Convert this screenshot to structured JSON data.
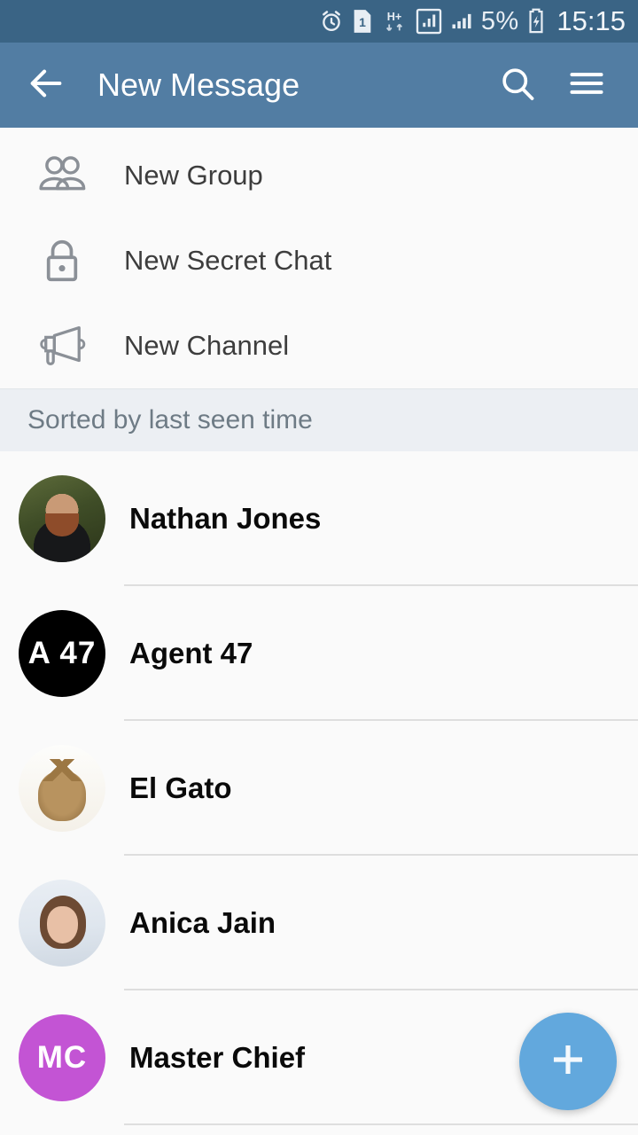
{
  "status_bar": {
    "icons": [
      "alarm-clock-icon",
      "sim-card-1-icon",
      "hplus-network-icon",
      "signal-data-icon",
      "signal-bars-icon"
    ],
    "battery_percent": "5%",
    "battery_state": "charging",
    "clock": "15:15"
  },
  "app_bar": {
    "back_label": "back-arrow",
    "title": "New Message",
    "search_label": "search",
    "menu_label": "menu"
  },
  "action_menu": [
    {
      "icon": "people-icon",
      "label": "New Group"
    },
    {
      "icon": "lock-icon",
      "label": "New Secret Chat"
    },
    {
      "icon": "megaphone-icon",
      "label": "New Channel"
    }
  ],
  "sort_header": {
    "label": "Sorted by last seen time"
  },
  "contacts": [
    {
      "name": "Nathan Jones",
      "avatar_type": "photo",
      "avatar_photo": "bearded-man-portrait"
    },
    {
      "name": "Agent 47",
      "avatar_type": "initials",
      "initials": "A 47",
      "color": "#000000"
    },
    {
      "name": "El Gato",
      "avatar_type": "photo",
      "avatar_photo": "tabby-cat"
    },
    {
      "name": "Anica Jain",
      "avatar_type": "photo",
      "avatar_photo": "woman-portrait"
    },
    {
      "name": "Master Chief",
      "avatar_type": "initials",
      "initials": "MC",
      "color": "#c354d4"
    }
  ],
  "fab": {
    "label": "+",
    "color": "#62a8dd"
  },
  "colors": {
    "status_bar": "#3a6485",
    "app_bar": "#527da3",
    "background": "#fafafa",
    "sort_header_bg": "#eceff3",
    "divider": "#dedede",
    "icon_gray": "#8b9097",
    "text_primary": "#0a0a0a"
  }
}
